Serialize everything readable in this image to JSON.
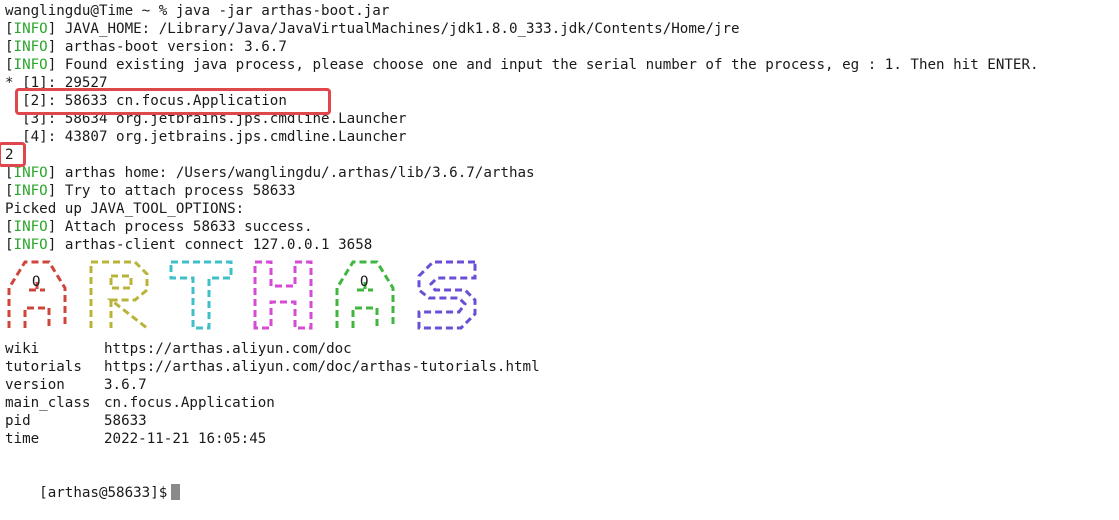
{
  "terminal": {
    "prompt_line": "wanglingdu@Time ~ % java -jar arthas-boot.jar",
    "tag_label": "INFO",
    "log_lines": [
      {
        "tag": true,
        "text": "JAVA_HOME: /Library/Java/JavaVirtualMachines/jdk1.8.0_333.jdk/Contents/Home/jre"
      },
      {
        "tag": true,
        "text": "arthas-boot version: 3.6.7"
      },
      {
        "tag": true,
        "text": "Found existing java process, please choose one and input the serial number of the process, eg : 1. Then hit ENTER."
      }
    ],
    "processes": [
      "* [1]: 29527",
      "  [2]: 58633 cn.focus.Application",
      "  [3]: 58634 org.jetbrains.jps.cmdline.Launcher",
      "  [4]: 43807 org.jetbrains.jps.cmdline.Launcher"
    ],
    "user_input": "2",
    "attach_lines": [
      {
        "tag": true,
        "text": "arthas home: /Users/wanglingdu/.arthas/lib/3.6.7/arthas"
      },
      {
        "tag": true,
        "text": "Try to attach process 58633"
      },
      {
        "tag": false,
        "text": "Picked up JAVA_TOOL_OPTIONS:"
      },
      {
        "tag": true,
        "text": "Attach process 58633 success."
      },
      {
        "tag": true,
        "text": "arthas-client connect 127.0.0.1 3658"
      }
    ],
    "logo": {
      "letters": [
        "A",
        "R",
        "T",
        "H",
        "A",
        "S"
      ],
      "colors": [
        "#d0453a",
        "#b8b43a",
        "#3fc0c8",
        "#d64ad6",
        "#3fb73f",
        "#6a4fd6"
      ]
    },
    "info": [
      {
        "key": "wiki",
        "value": "https://arthas.aliyun.com/doc"
      },
      {
        "key": "tutorials",
        "value": "https://arthas.aliyun.com/doc/arthas-tutorials.html"
      },
      {
        "key": "version",
        "value": "3.6.7"
      },
      {
        "key": "main_class",
        "value": "cn.focus.Application"
      },
      {
        "key": "pid",
        "value": "58633"
      },
      {
        "key": "time",
        "value": "2022-11-21 16:05:45"
      }
    ],
    "final_prompt": "[arthas@58633]$"
  }
}
